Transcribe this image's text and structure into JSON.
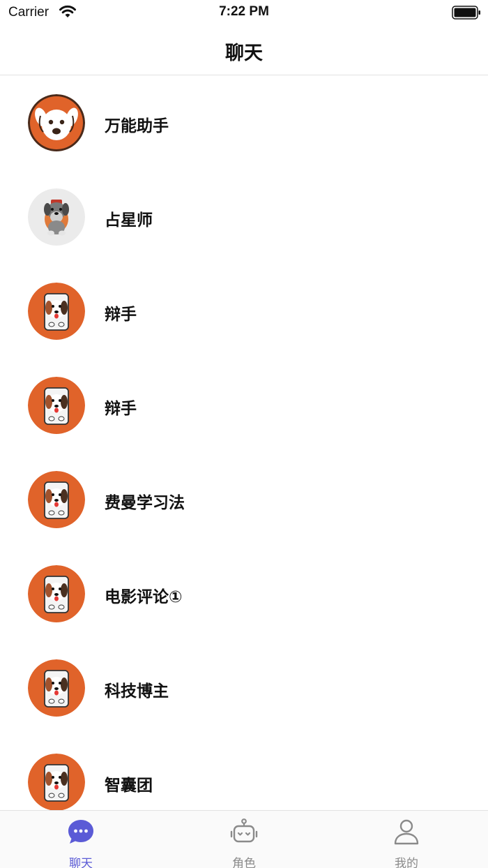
{
  "status_bar": {
    "carrier": "Carrier",
    "time": "7:22 PM"
  },
  "nav": {
    "title": "聊天"
  },
  "chats": [
    {
      "name": "万能助手",
      "avatar": "white-dog-face-icon"
    },
    {
      "name": "占星师",
      "avatar": "schnauzer-dog-icon"
    },
    {
      "name": "辩手",
      "avatar": "phone-dog-icon"
    },
    {
      "name": "辩手",
      "avatar": "phone-dog-icon"
    },
    {
      "name": "费曼学习法",
      "avatar": "phone-dog-icon"
    },
    {
      "name": "电影评论①",
      "avatar": "phone-dog-icon"
    },
    {
      "name": "科技博主",
      "avatar": "phone-dog-icon"
    },
    {
      "name": "智囊团",
      "avatar": "phone-dog-icon"
    }
  ],
  "tabs": [
    {
      "label": "聊天",
      "icon": "chat-bubble-icon",
      "active": true
    },
    {
      "label": "角色",
      "icon": "robot-icon",
      "active": false
    },
    {
      "label": "我的",
      "icon": "person-icon",
      "active": false
    }
  ],
  "colors": {
    "accent": "#5b5bd6",
    "avatar_orange": "#e0632a",
    "inactive": "#8a8a8a"
  }
}
